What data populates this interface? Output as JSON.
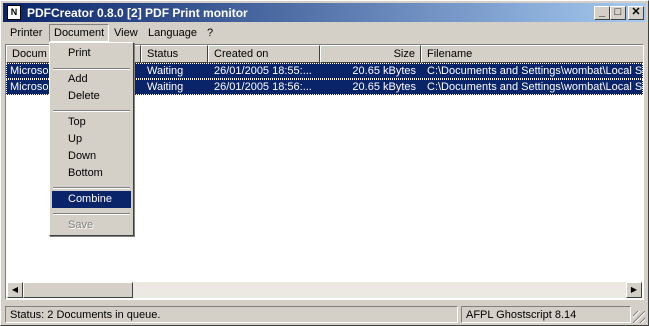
{
  "window": {
    "title": "PDFCreator 0.8.0 [2] PDF Print monitor",
    "icon": "pdf-app-icon"
  },
  "titlebar_buttons": {
    "minimize": "_",
    "maximize": "□",
    "close": "✕"
  },
  "menubar": {
    "items": [
      "Printer",
      "Document",
      "View",
      "Language",
      "?"
    ]
  },
  "document_menu": {
    "items": [
      "Print",
      "Add",
      "Delete",
      "Top",
      "Up",
      "Down",
      "Bottom",
      "Combine",
      "Save"
    ],
    "selected": "Combine",
    "disabled": [
      "Save"
    ]
  },
  "table": {
    "columns": [
      "Docum",
      "Status",
      "Created on",
      "Size",
      "Filename"
    ],
    "rows": [
      {
        "document": "Microso",
        "status": "Waiting",
        "created": "26/01/2005 18:55:...",
        "size": "20.65 kBytes",
        "filename": "C:\\Documents and Settings\\wombat\\Local Se"
      },
      {
        "document": "Microso",
        "status": "Waiting",
        "created": "26/01/2005 18:56:...",
        "size": "20.65 kBytes",
        "filename": "C:\\Documents and Settings\\wombat\\Local Se"
      }
    ]
  },
  "statusbar": {
    "status": "Status: 2 Documents in queue.",
    "ghostscript": "AFPL Ghostscript 8.14"
  },
  "colors": {
    "selection": "#0a246a",
    "face": "#d4d0c8"
  }
}
